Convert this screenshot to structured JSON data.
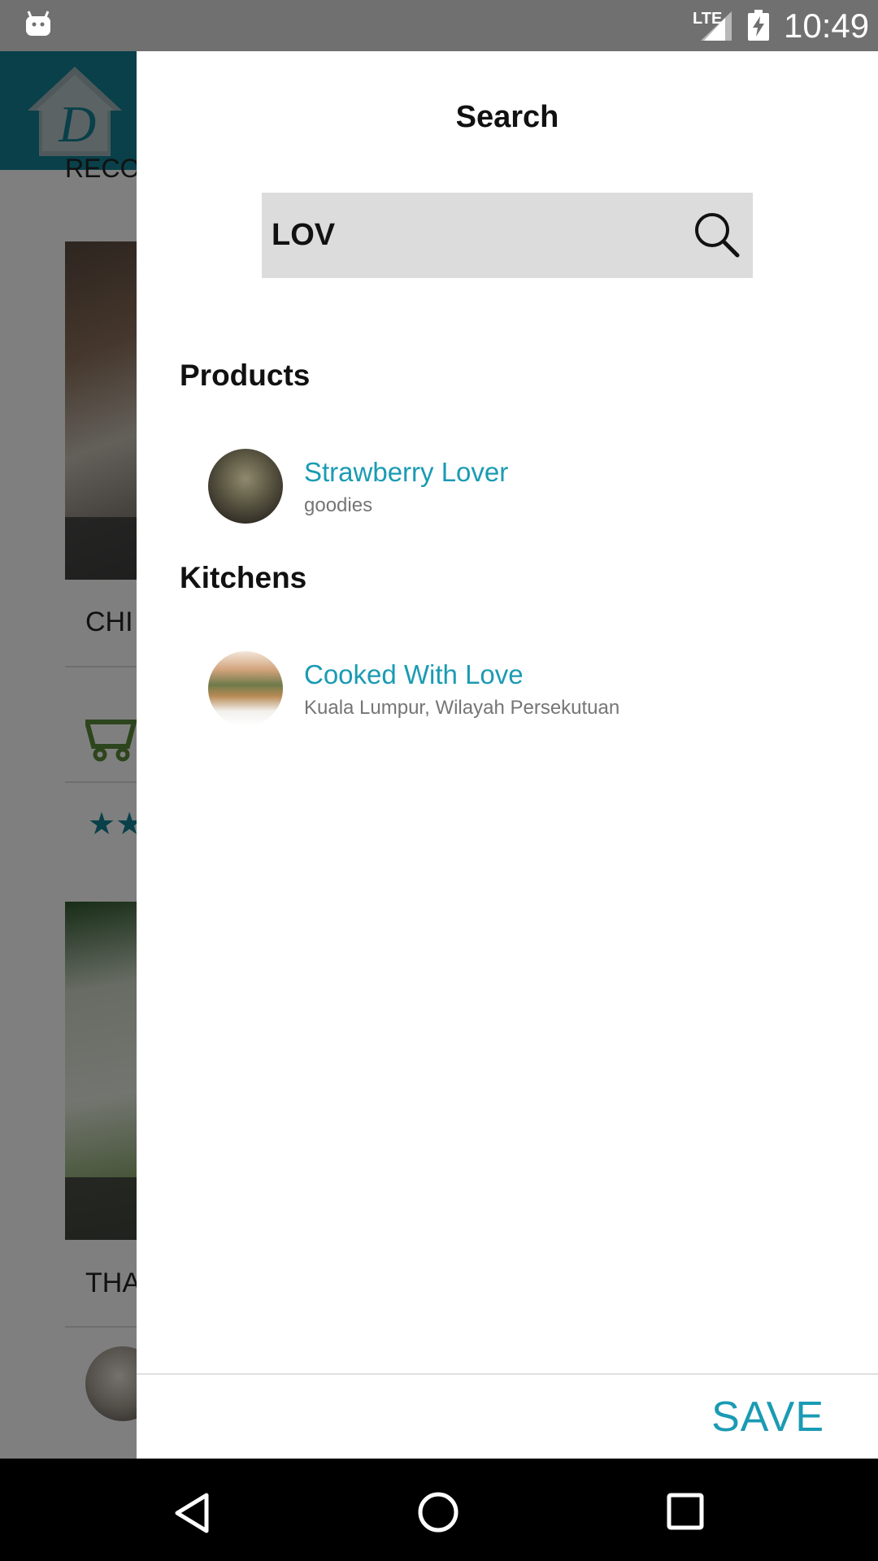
{
  "status_bar": {
    "network": "LTE",
    "time": "10:49",
    "icons": [
      "android-icon",
      "signal-icon",
      "battery-charging-icon"
    ]
  },
  "background": {
    "section_heading": "RECO",
    "card1_title": "CHI",
    "card2_title": "THA",
    "rating_stars": "★★"
  },
  "drawer": {
    "title": "Search",
    "search": {
      "value": "LOV",
      "icon": "search-icon"
    },
    "sections": [
      {
        "title": "Products",
        "items": [
          {
            "name": "Strawberry Lover",
            "subtitle": "goodies"
          }
        ]
      },
      {
        "title": "Kitchens",
        "items": [
          {
            "name": "Cooked With Love",
            "subtitle": "Kuala Lumpur, Wilayah Persekutuan"
          }
        ]
      }
    ],
    "save_label": "SAVE"
  },
  "colors": {
    "accent": "#1a9bb3",
    "header": "#138195",
    "search_bg": "#dcdcdc"
  },
  "nav_bar": {
    "icons": [
      "back-icon",
      "home-icon",
      "recents-icon"
    ]
  }
}
